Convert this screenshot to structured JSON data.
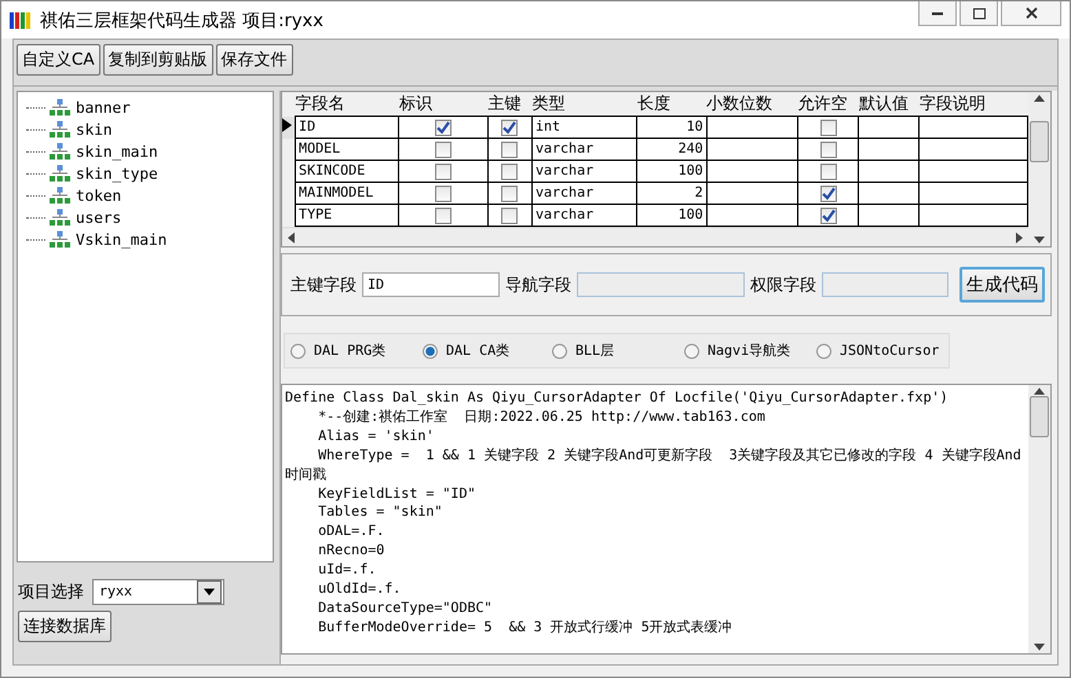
{
  "window": {
    "title": "祺佑三层框架代码生成器 项目:ryxx"
  },
  "toolbar": [
    "自定义CA",
    "复制到剪贴版",
    "保存文件"
  ],
  "tables": [
    {
      "label": "banner",
      "selected": false
    },
    {
      "label": "skin",
      "selected": false
    },
    {
      "label": "skin_main",
      "selected": false
    },
    {
      "label": "skin_type",
      "selected": false
    },
    {
      "label": "token",
      "selected": false
    },
    {
      "label": "users",
      "selected": false
    },
    {
      "label": "Vskin_main",
      "selected": false
    }
  ],
  "project": {
    "label": "项目选择",
    "value": "ryxx"
  },
  "connect_button": "连接数据库",
  "grid": {
    "columns": [
      "字段名",
      "标识",
      "主键",
      "类型",
      "长度",
      "小数位数",
      "允许空",
      "默认值",
      "字段说明"
    ],
    "rows": [
      {
        "selected": true,
        "name": "ID",
        "identity": true,
        "primary": true,
        "type": "int",
        "length": "10",
        "nullable": false
      },
      {
        "selected": false,
        "name": "MODEL",
        "identity": false,
        "primary": false,
        "type": "varchar",
        "length": "240",
        "nullable": false
      },
      {
        "selected": false,
        "name": "SKINCODE",
        "identity": false,
        "primary": false,
        "type": "varchar",
        "length": "100",
        "nullable": false
      },
      {
        "selected": false,
        "name": "MAINMODEL",
        "identity": false,
        "primary": false,
        "type": "varchar",
        "length": "2",
        "nullable": true
      },
      {
        "selected": false,
        "name": "TYPE",
        "identity": false,
        "primary": false,
        "type": "varchar",
        "length": "100",
        "nullable": true
      }
    ]
  },
  "fields": [
    {
      "label": "主键字段",
      "value": "ID",
      "disabled": false
    },
    {
      "label": "导航字段",
      "disabled": true
    },
    {
      "label": "权限字段",
      "disabled": true
    }
  ],
  "generate_button": "生成代码",
  "modes": [
    {
      "label": "DAL PRG类",
      "selected": false
    },
    {
      "label": "DAL CA类",
      "selected": true
    },
    {
      "label": "BLL层",
      "selected": false
    },
    {
      "label": "Nagvi导航类",
      "selected": false
    },
    {
      "label": "JSONtoCursor",
      "selected": false
    }
  ],
  "code": [
    "Define Class Dal_skin As Qiyu_CursorAdapter Of Locfile('Qiyu_CursorAdapter.fxp')",
    "    *--创建:祺佑工作室  日期:2022.06.25 http://www.tab163.com",
    "    Alias = 'skin'",
    "    WhereType =  1 && 1 关键字段 2 关键字段And可更新字段  3关键字段及其它已修改的字段 4 关键字段And时间戳",
    "    KeyFieldList = \"ID\"",
    "    Tables = \"skin\"",
    "    oDAL=.F.",
    "    nRecno=0",
    "    uId=.f.",
    "    uOldId=.f.",
    "    DataSourceType=\"ODBC\"",
    "    BufferModeOverride= 5  && 3 开放式行缓冲 5开放式表缓冲"
  ]
}
